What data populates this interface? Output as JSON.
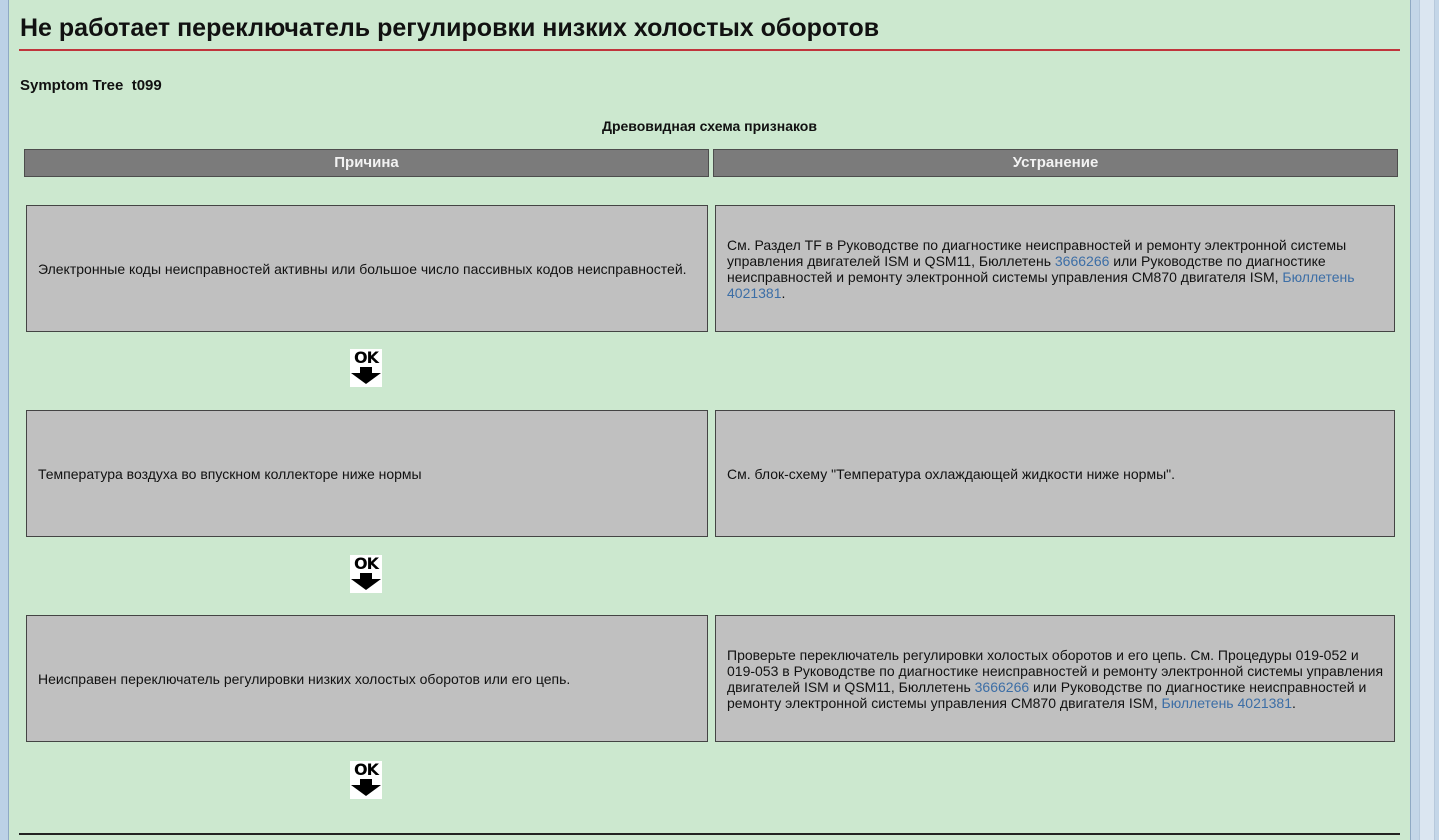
{
  "title": "Не работает переключатель регулировки низких холостых оборотов",
  "tree_id": "Symptom Tree  t099",
  "caption": "Древовидная схема признаков",
  "columns": {
    "cause": "Причина",
    "fix": "Устранение"
  },
  "rows": [
    {
      "cause": "Электронные коды неисправностей активны или большое число пассивных кодов неисправностей.",
      "fix": {
        "t1": "См. Раздел TF в Руководстве по диагностике неисправностей и ремонту электронной системы управления двигателей ISM и QSM11, Бюллетень ",
        "link1": "3666266",
        "t2": " или Руководстве по диагностике неисправностей и ремонту электронной системы управления CM870 двигателя ISM, ",
        "link2": "Бюллетень 4021381",
        "t3": "."
      },
      "ok_label": "OK"
    },
    {
      "cause": "Температура воздуха во впускном коллекторе ниже нормы",
      "fix": {
        "t1": "См. блок-схему \"Температура охлаждающей жидкости ниже нормы\"."
      },
      "ok_label": "OK"
    },
    {
      "cause": "Неисправен переключатель регулировки низких холостых оборотов или его цепь.",
      "fix": {
        "t1": "Проверьте переключатель регулировки холостых оборотов и его цепь. См. Процедуры 019-052 и 019-053 в Руководстве по диагностике неисправностей и ремонту электронной системы управления двигателей ISM и QSM11, Бюллетень ",
        "link1": "3666266",
        "t2": " или Руководстве по диагностике неисправностей и ремонту электронной системы управления CM870 двигателя ISM, ",
        "link2": "Бюллетень 4021381",
        "t3": "."
      },
      "ok_label": "OK"
    }
  ],
  "colors": {
    "page_bg": "#cce8cf",
    "header_bg": "#7b7b7b",
    "cell_bg": "#c0c0c0",
    "link": "#3c6ea6",
    "title_rule": "#c0343c"
  },
  "icons": {
    "ok_arrow": "ok-down-arrow-icon"
  }
}
